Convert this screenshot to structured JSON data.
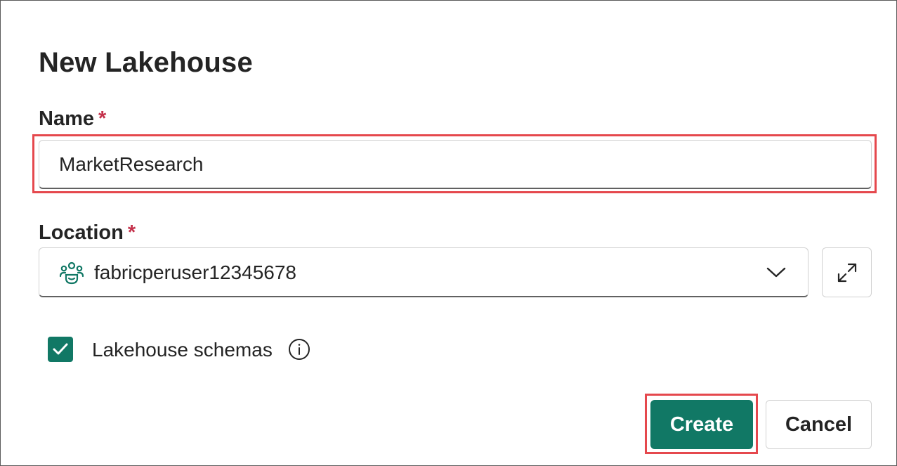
{
  "dialog": {
    "title": "New Lakehouse",
    "name_field": {
      "label": "Name",
      "required_marker": "*",
      "value": "MarketResearch"
    },
    "location_field": {
      "label": "Location",
      "required_marker": "*",
      "value": "fabricperuser12345678",
      "icon": "workspace-icon"
    },
    "schemas_checkbox": {
      "label": "Lakehouse schemas",
      "checked": true,
      "info_icon": "info-icon"
    },
    "buttons": {
      "create": "Create",
      "cancel": "Cancel"
    }
  },
  "colors": {
    "accent": "#117865",
    "required": "#c4314b",
    "highlight": "#e5484d",
    "text": "#242424"
  }
}
